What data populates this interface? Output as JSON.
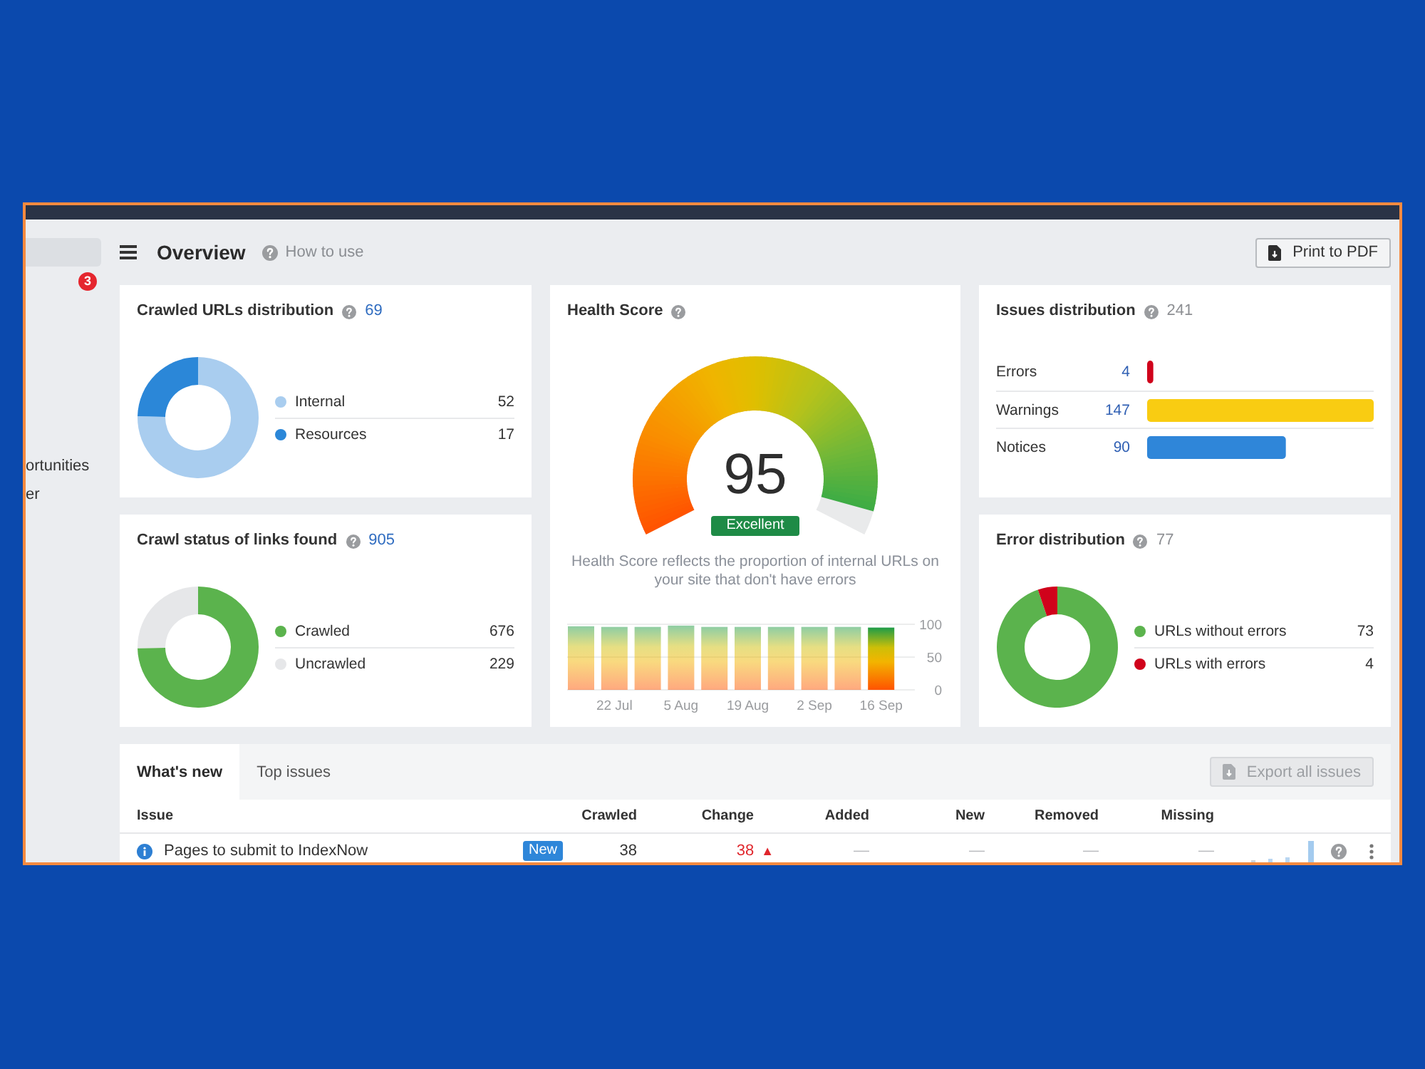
{
  "sidebar": {
    "items": [
      {
        "selected": true
      },
      {
        "selected": false,
        "badge": "3"
      },
      {
        "selected": false,
        "label": "ortunities"
      },
      {
        "selected": false,
        "label": "er"
      }
    ]
  },
  "header": {
    "title": "Overview",
    "help_link": "How to use",
    "print_button": "Print to PDF"
  },
  "cards": [
    {
      "kind": "donut",
      "title": "Crawled URLs distribution",
      "count": "69",
      "count_linked": true,
      "slices": [
        {
          "color": "#a9cdef"
        },
        {
          "color": "#2b87d8"
        }
      ],
      "chart_data": {
        "type": "donut",
        "categories": [
          "Internal",
          "Resources"
        ],
        "values": [
          52,
          17
        ],
        "value_labels": [
          "52",
          "17"
        ],
        "legend": "right"
      }
    },
    {
      "kind": "health",
      "title": "Health Score",
      "gauge": {
        "level": 0.95,
        "score": "95",
        "rating": "Excellent"
      },
      "description": "Health Score reflects the proportion of internal URLs on your site that don't have errors",
      "chart_data": {
        "type": "bar",
        "categories": [
          null,
          "22 Jul",
          null,
          "5 Aug",
          null,
          "19 Aug",
          null,
          "2 Sep",
          null,
          "16 Sep"
        ],
        "values": [
          97,
          96,
          96,
          98,
          96,
          96,
          96,
          96,
          96,
          95
        ],
        "ylim": [
          0,
          100
        ],
        "yticks": [
          0,
          50,
          100
        ]
      }
    },
    {
      "kind": "bars",
      "title": "Issues distribution",
      "count": "241",
      "count_linked": false,
      "bars": [
        {
          "color": "#d0021b"
        },
        {
          "color": "#f9cc12"
        },
        {
          "color": "#2f86d9"
        }
      ],
      "chart_data": {
        "type": "bar",
        "orientation": "horizontal",
        "categories": [
          "Errors",
          "Warnings",
          "Notices"
        ],
        "values": [
          4,
          147,
          90
        ],
        "value_labels": [
          "4",
          "147",
          "90"
        ]
      }
    },
    {
      "kind": "donut",
      "title": "Crawl status of links found",
      "count": "905",
      "count_linked": true,
      "slices": [
        {
          "color": "#5bb34d"
        },
        {
          "color": "#e6e7e9"
        }
      ],
      "chart_data": {
        "type": "donut",
        "categories": [
          "Crawled",
          "Uncrawled"
        ],
        "values": [
          676,
          229
        ],
        "value_labels": [
          "676",
          "229"
        ],
        "legend": "right"
      }
    },
    {
      "kind": "donut",
      "title": "Error distribution",
      "count": "77",
      "count_linked": false,
      "slices": [
        {
          "color": "#5bb34d"
        },
        {
          "color": "#d0021b"
        }
      ],
      "chart_data": {
        "type": "donut",
        "categories": [
          "URLs without errors",
          "URLs with errors"
        ],
        "values": [
          73,
          4
        ],
        "value_labels": [
          "73",
          "4"
        ],
        "legend": "right"
      }
    }
  ],
  "issues_panel": {
    "tabs": [
      {
        "label": "What's new",
        "selected": true
      },
      {
        "label": "Top issues",
        "selected": false
      }
    ],
    "export_button": {
      "label": "Export all issues",
      "disabled": true
    },
    "columns": [
      "Issue",
      "Crawled",
      "Change",
      "Added",
      "New",
      "Removed",
      "Missing"
    ],
    "rows": [
      {
        "issue": "Pages to submit to IndexNow",
        "badge": "New",
        "crawled": "38",
        "change": "38",
        "change_arrow": "▲",
        "added": "—",
        "new": "—",
        "removed": "—",
        "missing": "—"
      }
    ]
  }
}
